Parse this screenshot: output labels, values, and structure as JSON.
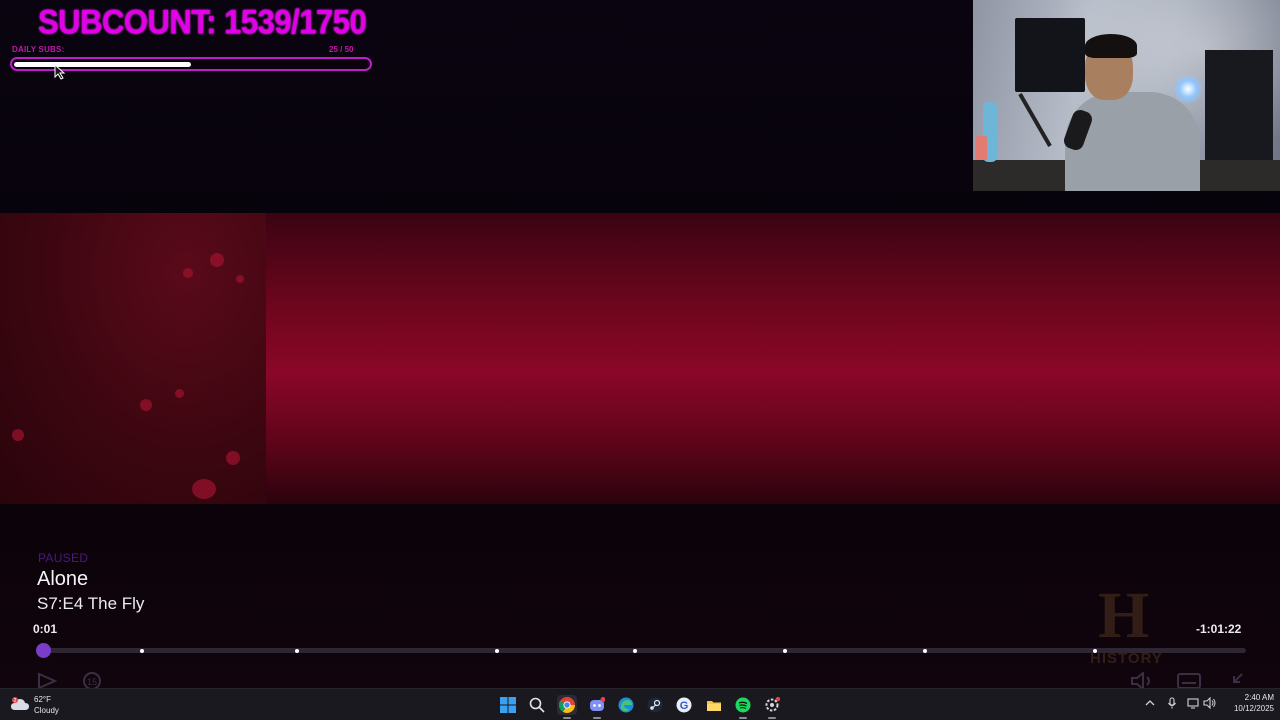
{
  "overlay": {
    "subcount": "SUBCOUNT: 1539/1750",
    "daily_label": "DAILY SUBS:",
    "daily_count": "25  / 50",
    "daily_progress": 0.5
  },
  "player": {
    "status": "PAUSED",
    "show_title": "Alone",
    "episode": "S7:E4 The Fly",
    "time_current": "0:01",
    "time_remaining": "-1:01:22",
    "progress": 0.002,
    "chapter_markers": [
      0.086,
      0.214,
      0.38,
      0.494,
      0.618,
      0.734,
      0.875
    ],
    "network_logo": "HISTORY",
    "controls": {
      "play": "play-icon",
      "skip_back": "replay-15-icon",
      "skip_back_label": "15",
      "volume": "volume-muted-icon",
      "subtitles": "subtitles-icon",
      "exit_fullscreen": "minimize-icon"
    }
  },
  "taskbar": {
    "weather": {
      "temp": "62°F",
      "condition": "Cloudy",
      "badge": "2"
    },
    "apps": [
      "start",
      "search",
      "chrome",
      "discord",
      "edge",
      "steam",
      "app-g",
      "file-explorer",
      "spotify",
      "app-settings"
    ],
    "clock": {
      "time": "2:40 AM",
      "date": "10/12/2025"
    }
  },
  "colors": {
    "accent_purple": "#7b3cc8",
    "overlay_magenta": "#e100e8",
    "video_red": "#8a0728"
  }
}
